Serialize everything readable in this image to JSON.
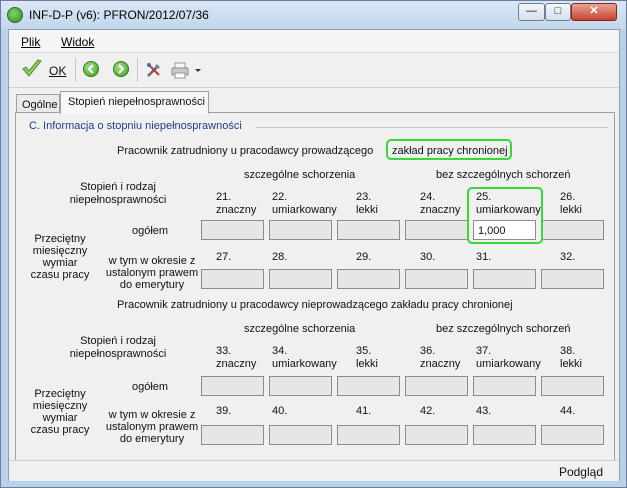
{
  "window": {
    "title": "INF-D-P (v6): PFRON/2012/07/36",
    "controls": {
      "minimize": "—",
      "maximize": "□",
      "close": "✕"
    }
  },
  "menu": {
    "plik": "Plik",
    "widok": "Widok"
  },
  "toolbar": {
    "ok_label": "OK",
    "icons": [
      "check-icon",
      "back-icon",
      "forward-icon",
      "tools-icon",
      "print-icon",
      "dropdown-arrow-icon"
    ]
  },
  "tabs": {
    "ogolne": "Ogólne",
    "stopien": "Stopień niepełnosprawności"
  },
  "section": {
    "title": "C. Informacja o stopniu niepełnosprawności"
  },
  "block1": {
    "heading_a": "Pracownik zatrudniony u pracodawcy prowadzącego",
    "heading_b": "zakład pracy chronionej",
    "group_left": "szczególne schorzenia",
    "group_right": "bez szczególnych schorzeń",
    "row_label_1": "Stopień i rodzaj",
    "row_label_2": "niepełnosprawności",
    "cols": [
      {
        "num": "21.",
        "name": "znaczny"
      },
      {
        "num": "22.",
        "name": "umiarkowany"
      },
      {
        "num": "23.",
        "name": "lekki"
      },
      {
        "num": "24.",
        "name": "znaczny"
      },
      {
        "num": "25.",
        "name": "umiarkowany"
      },
      {
        "num": "26.",
        "name": "lekki"
      }
    ],
    "side_label": [
      "Przeciętny",
      "miesięczny",
      "wymiar",
      "czasu pracy"
    ],
    "ogolem": "ogółem",
    "values": [
      "",
      "",
      "",
      "",
      "1,000",
      ""
    ],
    "retire_label": [
      "w tym w okresie z",
      "ustalonym prawem",
      "do emerytury"
    ],
    "retire_nums": [
      "27.",
      "28.",
      "29.",
      "30.",
      "31.",
      "32."
    ]
  },
  "block2": {
    "heading": "Pracownik zatrudniony u pracodawcy nieprowadzącego zakładu pracy chronionej",
    "group_left": "szczególne schorzenia",
    "group_right": "bez szczególnych schorzeń",
    "row_label_1": "Stopień i rodzaj",
    "row_label_2": "niepełnosprawności",
    "cols": [
      {
        "num": "33.",
        "name": "znaczny"
      },
      {
        "num": "34.",
        "name": "umiarkowany"
      },
      {
        "num": "35.",
        "name": "lekki"
      },
      {
        "num": "36.",
        "name": "znaczny"
      },
      {
        "num": "37.",
        "name": "umiarkowany"
      },
      {
        "num": "38.",
        "name": "lekki"
      }
    ],
    "side_label": [
      "Przeciętny",
      "miesięczny",
      "wymiar",
      "czasu pracy"
    ],
    "ogolem": "ogółem",
    "values": [
      "",
      "",
      "",
      "",
      "",
      ""
    ],
    "retire_label": [
      "w tym w okresie z",
      "ustalonym prawem",
      "do emerytury"
    ],
    "retire_nums": [
      "39.",
      "40.",
      "41.",
      "42.",
      "43.",
      "44."
    ]
  },
  "status": {
    "text": "Podgląd"
  },
  "colors": {
    "highlight": "#38d838",
    "section_title": "#1c3f86",
    "titlebar": "#c3d6ec"
  }
}
